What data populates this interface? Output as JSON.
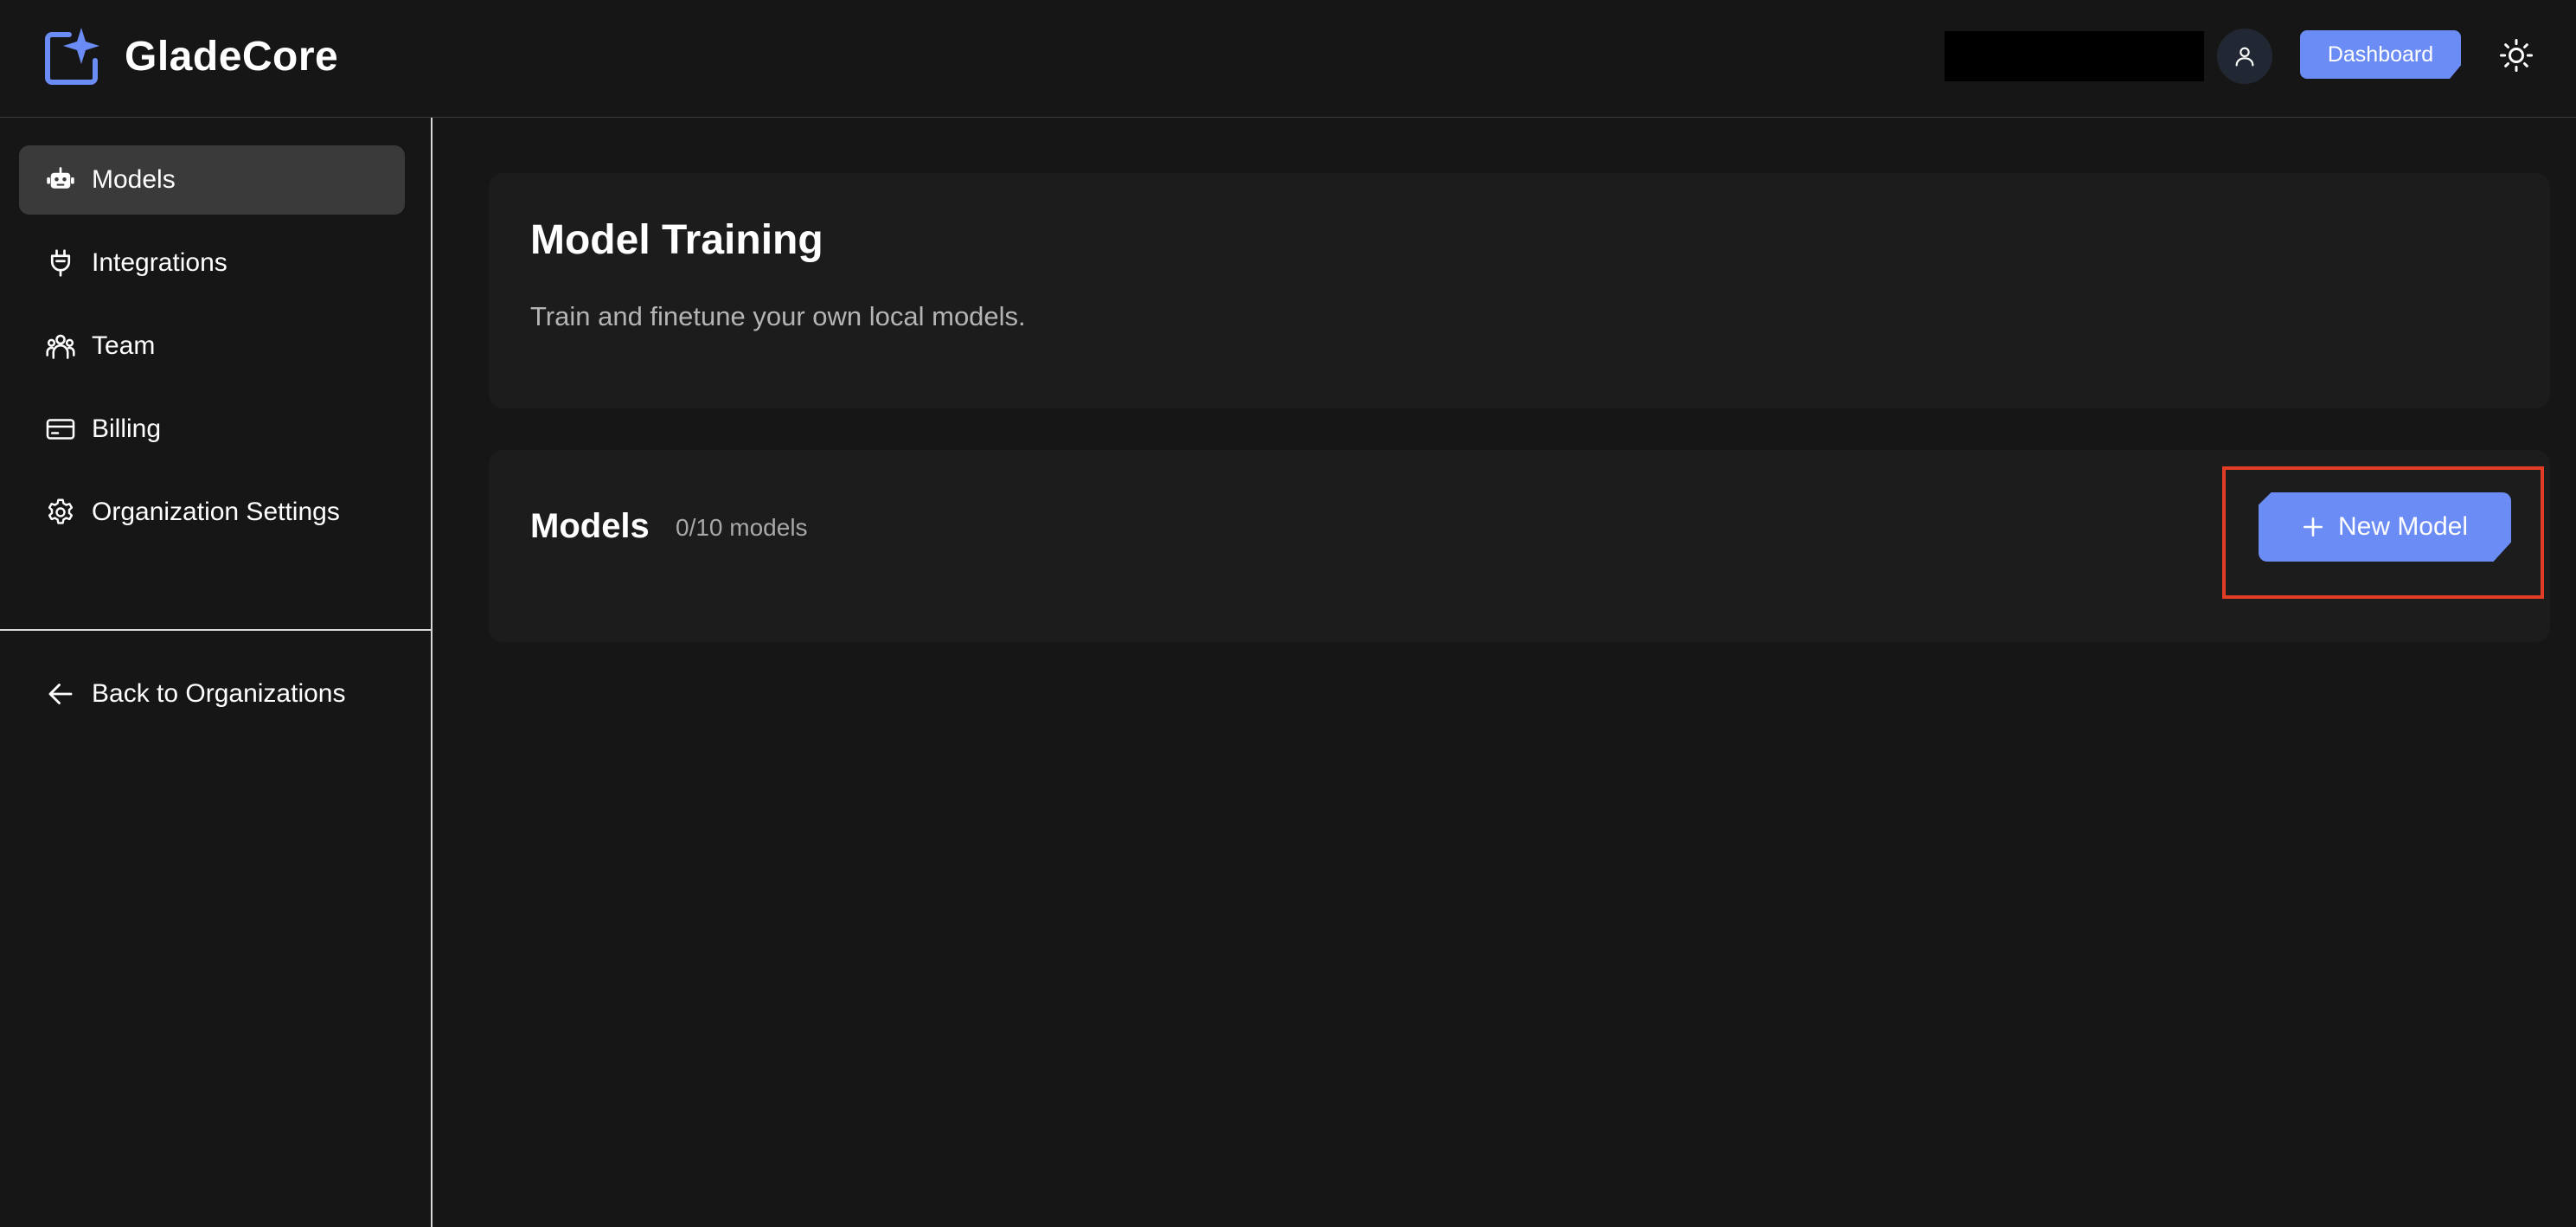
{
  "app": {
    "name": "GladeCore",
    "logo_icon": "sparkle-logo-icon"
  },
  "header": {
    "dashboard_label": "Dashboard",
    "avatar_icon": "user-icon",
    "theme_toggle_icon": "sun-icon"
  },
  "sidebar": {
    "items": [
      {
        "label": "Models",
        "icon": "robot-icon",
        "active": true
      },
      {
        "label": "Integrations",
        "icon": "plug-icon",
        "active": false
      },
      {
        "label": "Team",
        "icon": "team-icon",
        "active": false
      },
      {
        "label": "Billing",
        "icon": "credit-card-icon",
        "active": false
      },
      {
        "label": "Organization Settings",
        "icon": "gear-icon",
        "active": false
      }
    ],
    "back_label": "Back to Organizations",
    "back_icon": "arrow-left-icon"
  },
  "main": {
    "title": "Model Training",
    "subtitle": "Train and finetune your own local models.",
    "models_section": {
      "title": "Models",
      "count": "0/10 models",
      "new_button_label": "New Model",
      "new_button_icon": "plus-icon"
    }
  },
  "colors": {
    "accent": "#6b8cf5",
    "background": "#161616",
    "card": "#1c1c1c",
    "active_nav": "#3a3a3a",
    "highlight": "#e23c24"
  }
}
